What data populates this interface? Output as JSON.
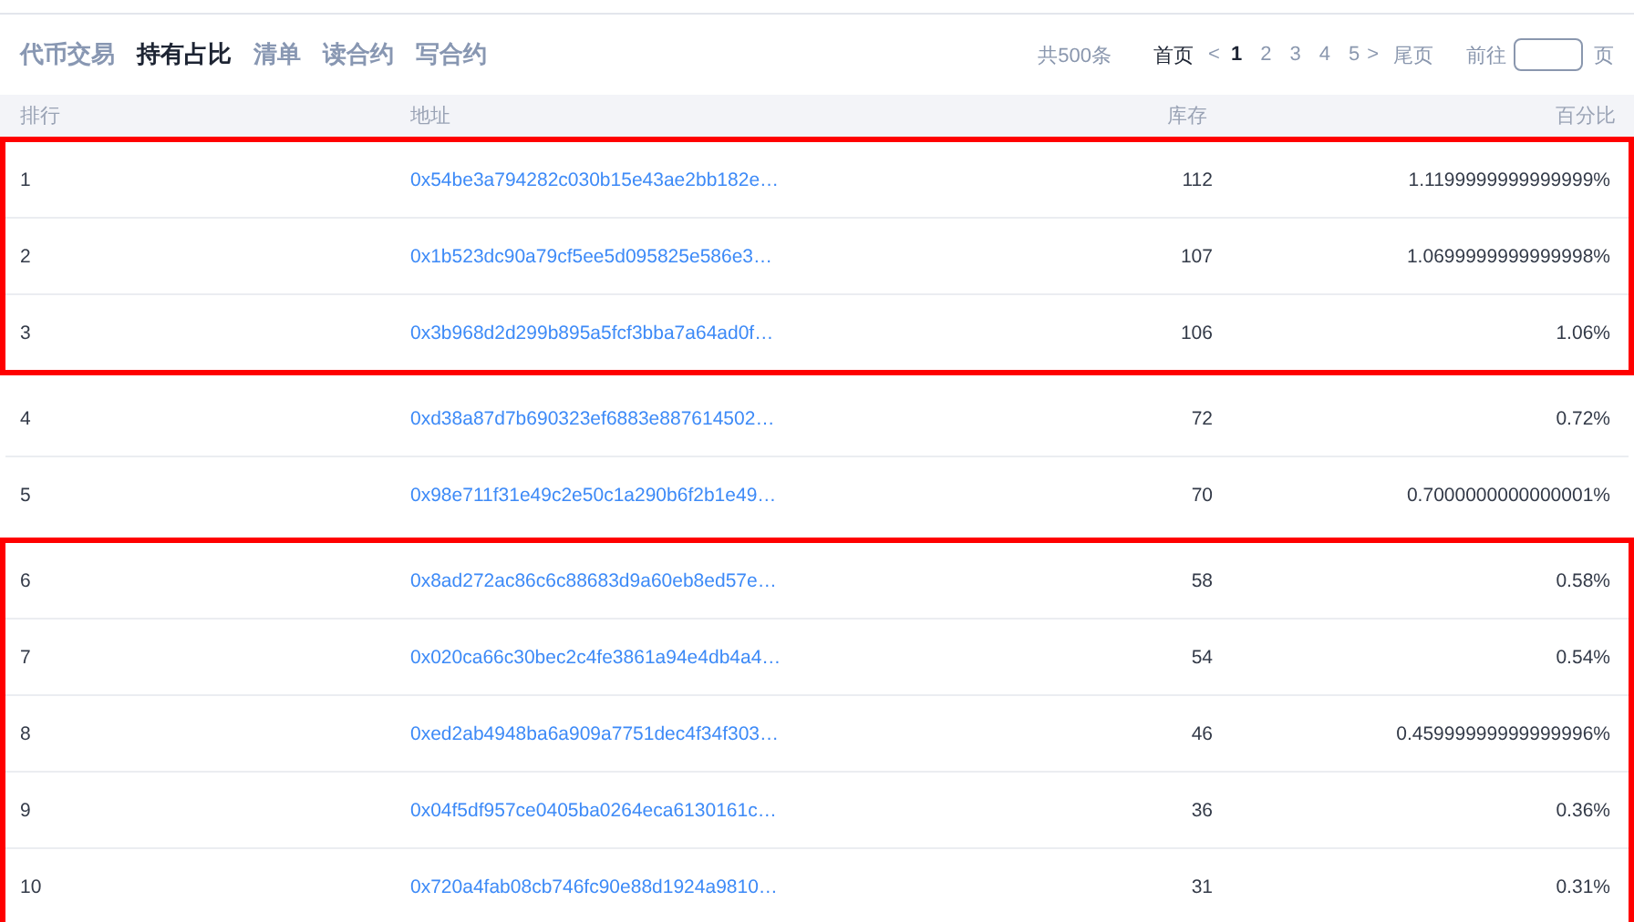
{
  "tabs": [
    {
      "label": "代币交易",
      "selected": false
    },
    {
      "label": "持有占比",
      "selected": true
    },
    {
      "label": "清单",
      "selected": false
    },
    {
      "label": "读合约",
      "selected": false
    },
    {
      "label": "写合约",
      "selected": false
    }
  ],
  "pagination": {
    "total": "共500条",
    "first": "首页",
    "prev": "<",
    "pages": [
      {
        "label": "1",
        "selected": true
      },
      {
        "label": "2",
        "selected": false
      },
      {
        "label": "3",
        "selected": false
      },
      {
        "label": "4",
        "selected": false
      },
      {
        "label": "5",
        "selected": false
      }
    ],
    "next": ">",
    "last": "尾页",
    "goto_label": "前往",
    "goto_suffix": "页"
  },
  "table": {
    "columns": [
      "排行",
      "地址",
      "库存",
      "百分比"
    ],
    "row_groups": [
      {
        "highlighted": true,
        "rows": [
          {
            "rank": "1",
            "address": "0x54be3a794282c030b15e43ae2bb182e…",
            "stock": "112",
            "percent": "1.1199999999999999%"
          },
          {
            "rank": "2",
            "address": "0x1b523dc90a79cf5ee5d095825e586e3…",
            "stock": "107",
            "percent": "1.0699999999999998%"
          },
          {
            "rank": "3",
            "address": "0x3b968d2d299b895a5fcf3bba7a64ad0f…",
            "stock": "106",
            "percent": "1.06%"
          }
        ]
      },
      {
        "highlighted": false,
        "rows": [
          {
            "rank": "4",
            "address": "0xd38a87d7b690323ef6883e887614502…",
            "stock": "72",
            "percent": "0.72%"
          },
          {
            "rank": "5",
            "address": "0x98e711f31e49c2e50c1a290b6f2b1e49…",
            "stock": "70",
            "percent": "0.7000000000000001%"
          }
        ]
      },
      {
        "highlighted": true,
        "rows": [
          {
            "rank": "6",
            "address": "0x8ad272ac86c6c88683d9a60eb8ed57e…",
            "stock": "58",
            "percent": "0.58%"
          },
          {
            "rank": "7",
            "address": "0x020ca66c30bec2c4fe3861a94e4db4a4…",
            "stock": "54",
            "percent": "0.54%"
          },
          {
            "rank": "8",
            "address": "0xed2ab4948ba6a909a7751dec4f34f303…",
            "stock": "46",
            "percent": "0.45999999999999996%"
          },
          {
            "rank": "9",
            "address": "0x04f5df957ce0405ba0264eca6130161c…",
            "stock": "36",
            "percent": "0.36%"
          },
          {
            "rank": "10",
            "address": "0x720a4fab08cb746fc90e88d1924a9810…",
            "stock": "31",
            "percent": "0.31%"
          }
        ]
      }
    ]
  }
}
